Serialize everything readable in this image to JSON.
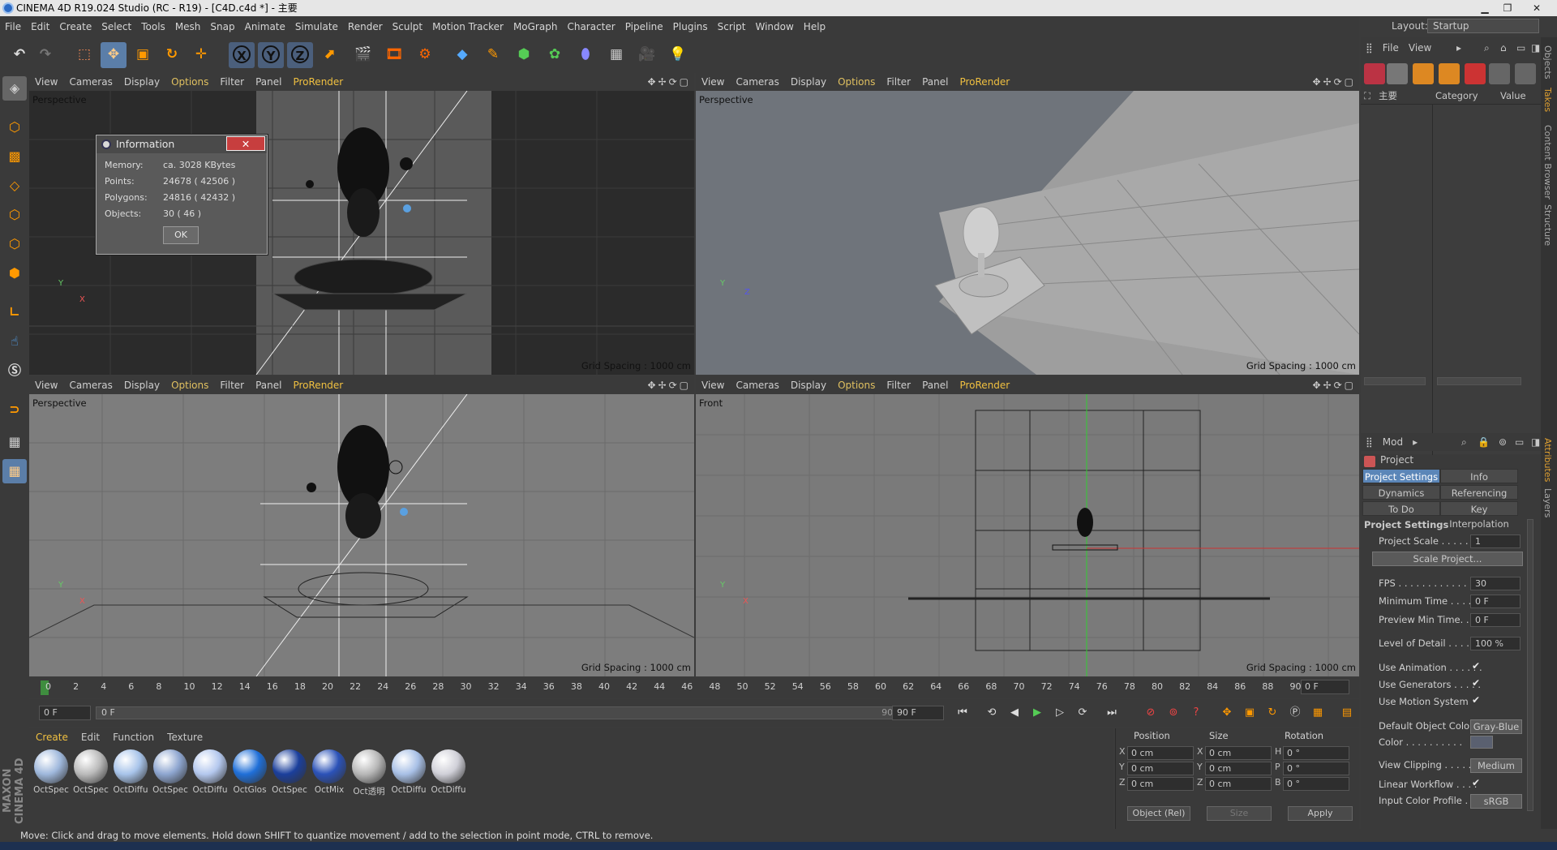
{
  "window": {
    "title": "CINEMA 4D R19.024 Studio (RC - R19) - [C4D.c4d *] - 主要"
  },
  "menu": [
    "File",
    "Edit",
    "Create",
    "Select",
    "Tools",
    "Mesh",
    "Snap",
    "Animate",
    "Simulate",
    "Render",
    "Sculpt",
    "Motion Tracker",
    "MoGraph",
    "Character",
    "Pipeline",
    "Plugins",
    "Script",
    "Window",
    "Help"
  ],
  "layout": {
    "label": "Layout:",
    "value": "Startup"
  },
  "viewport_menu": {
    "view": "View",
    "cameras": "Cameras",
    "display": "Display",
    "options": "Options",
    "filter": "Filter",
    "panel": "Panel",
    "prorender": "ProRender"
  },
  "viewports": [
    {
      "label": "Perspective",
      "grid": "Grid Spacing : 1000 cm"
    },
    {
      "label": "Perspective",
      "grid": "Grid Spacing : 1000 cm"
    },
    {
      "label": "Perspective",
      "grid": "Grid Spacing : 1000 cm"
    },
    {
      "label": "Front",
      "grid": "Grid Spacing : 1000 cm"
    }
  ],
  "info_dialog": {
    "title": "Information",
    "rows": [
      {
        "label": "Memory:",
        "value": "ca. 3028 KBytes"
      },
      {
        "label": "Points:",
        "value": "24678 ( 42506 )"
      },
      {
        "label": "Polygons:",
        "value": "24816 ( 42432 )"
      },
      {
        "label": "Objects:",
        "value": "30 ( 46 )"
      }
    ],
    "ok": "OK"
  },
  "timeline": {
    "ticks": [
      "0",
      "2",
      "4",
      "6",
      "8",
      "10",
      "12",
      "14",
      "16",
      "18",
      "20",
      "22",
      "24",
      "26",
      "28",
      "30",
      "32",
      "34",
      "36",
      "38",
      "40",
      "42",
      "44",
      "46",
      "48",
      "50",
      "52",
      "54",
      "56",
      "58",
      "60",
      "62",
      "64",
      "66",
      "68",
      "70",
      "72",
      "74",
      "76",
      "78",
      "80",
      "82",
      "84",
      "86",
      "88",
      "90"
    ],
    "current_frame": "0 F",
    "start": "0 F",
    "start_inner": "0 F",
    "end_inner": "90 F",
    "end": "90 F"
  },
  "materials": {
    "tabs": [
      "Create",
      "Edit",
      "Function",
      "Texture"
    ],
    "items": [
      "OctSpec",
      "OctSpec",
      "OctDiffu",
      "OctSpec",
      "OctDiffu",
      "OctGlos",
      "OctSpec",
      "OctMix",
      "Oct透明",
      "OctDiffu",
      "OctDiffu"
    ],
    "brand": "MAXON CINEMA 4D"
  },
  "coords": {
    "headers": [
      "Position",
      "Size",
      "Rotation"
    ],
    "rows": [
      {
        "a": "X",
        "pos": "0 cm",
        "b": "X",
        "size": "0 cm",
        "c": "H",
        "rot": "0 °"
      },
      {
        "a": "Y",
        "pos": "0 cm",
        "b": "Y",
        "size": "0 cm",
        "c": "P",
        "rot": "0 °"
      },
      {
        "a": "Z",
        "pos": "0 cm",
        "b": "Z",
        "size": "0 cm",
        "c": "B",
        "rot": "0 °"
      }
    ],
    "mode": "Object (Rel)",
    "size_mode": "Size",
    "apply": "Apply"
  },
  "status": "Move: Click and drag to move elements. Hold down SHIFT to quantize movement / add to the selection in point mode, CTRL to remove.",
  "object_manager": {
    "menu": [
      "File",
      "View"
    ],
    "columns": [
      "主要",
      "Category",
      "Value"
    ]
  },
  "attributes": {
    "menu": "Mod",
    "object": "Project",
    "tabs": [
      "Project Settings",
      "Info",
      "Dynamics",
      "Referencing",
      "To Do",
      "Key Interpolation"
    ],
    "section": "Project Settings",
    "fields": [
      {
        "label": "Project Scale . . . . . . . .",
        "value": "1"
      },
      {
        "label": "FPS . . . . . . . . . . . . . . .",
        "value": "30"
      },
      {
        "label": "Minimum Time . . . . . .",
        "value": "0 F"
      },
      {
        "label": "Preview Min Time. . . .",
        "value": "0 F"
      },
      {
        "label": "Level of Detail . . . . . .",
        "value": "100 %"
      }
    ],
    "scale_button": "Scale Project...",
    "checks": [
      "Use Animation . . . . . .",
      "Use Generators . . . . .",
      "Use Motion System"
    ],
    "default_color_label": "Default Object Color",
    "default_color_value": "Gray-Blue",
    "color_label": "Color . . . . . . . . . .",
    "view_clipping_label": "View Clipping . . . . . .",
    "view_clipping_value": "Medium",
    "linear_label": "Linear Workflow . . . .",
    "input_profile_label": "Input Color Profile . .",
    "input_profile_value": "sRGB"
  },
  "side_tabs": [
    "Objects",
    "Takes",
    "Content Browser",
    "Structure",
    "Attributes",
    "Layers"
  ],
  "colors": {
    "accent": "#5b86b8",
    "highlight": "#f0c040",
    "viewport_bg": "#7a7a7a"
  }
}
